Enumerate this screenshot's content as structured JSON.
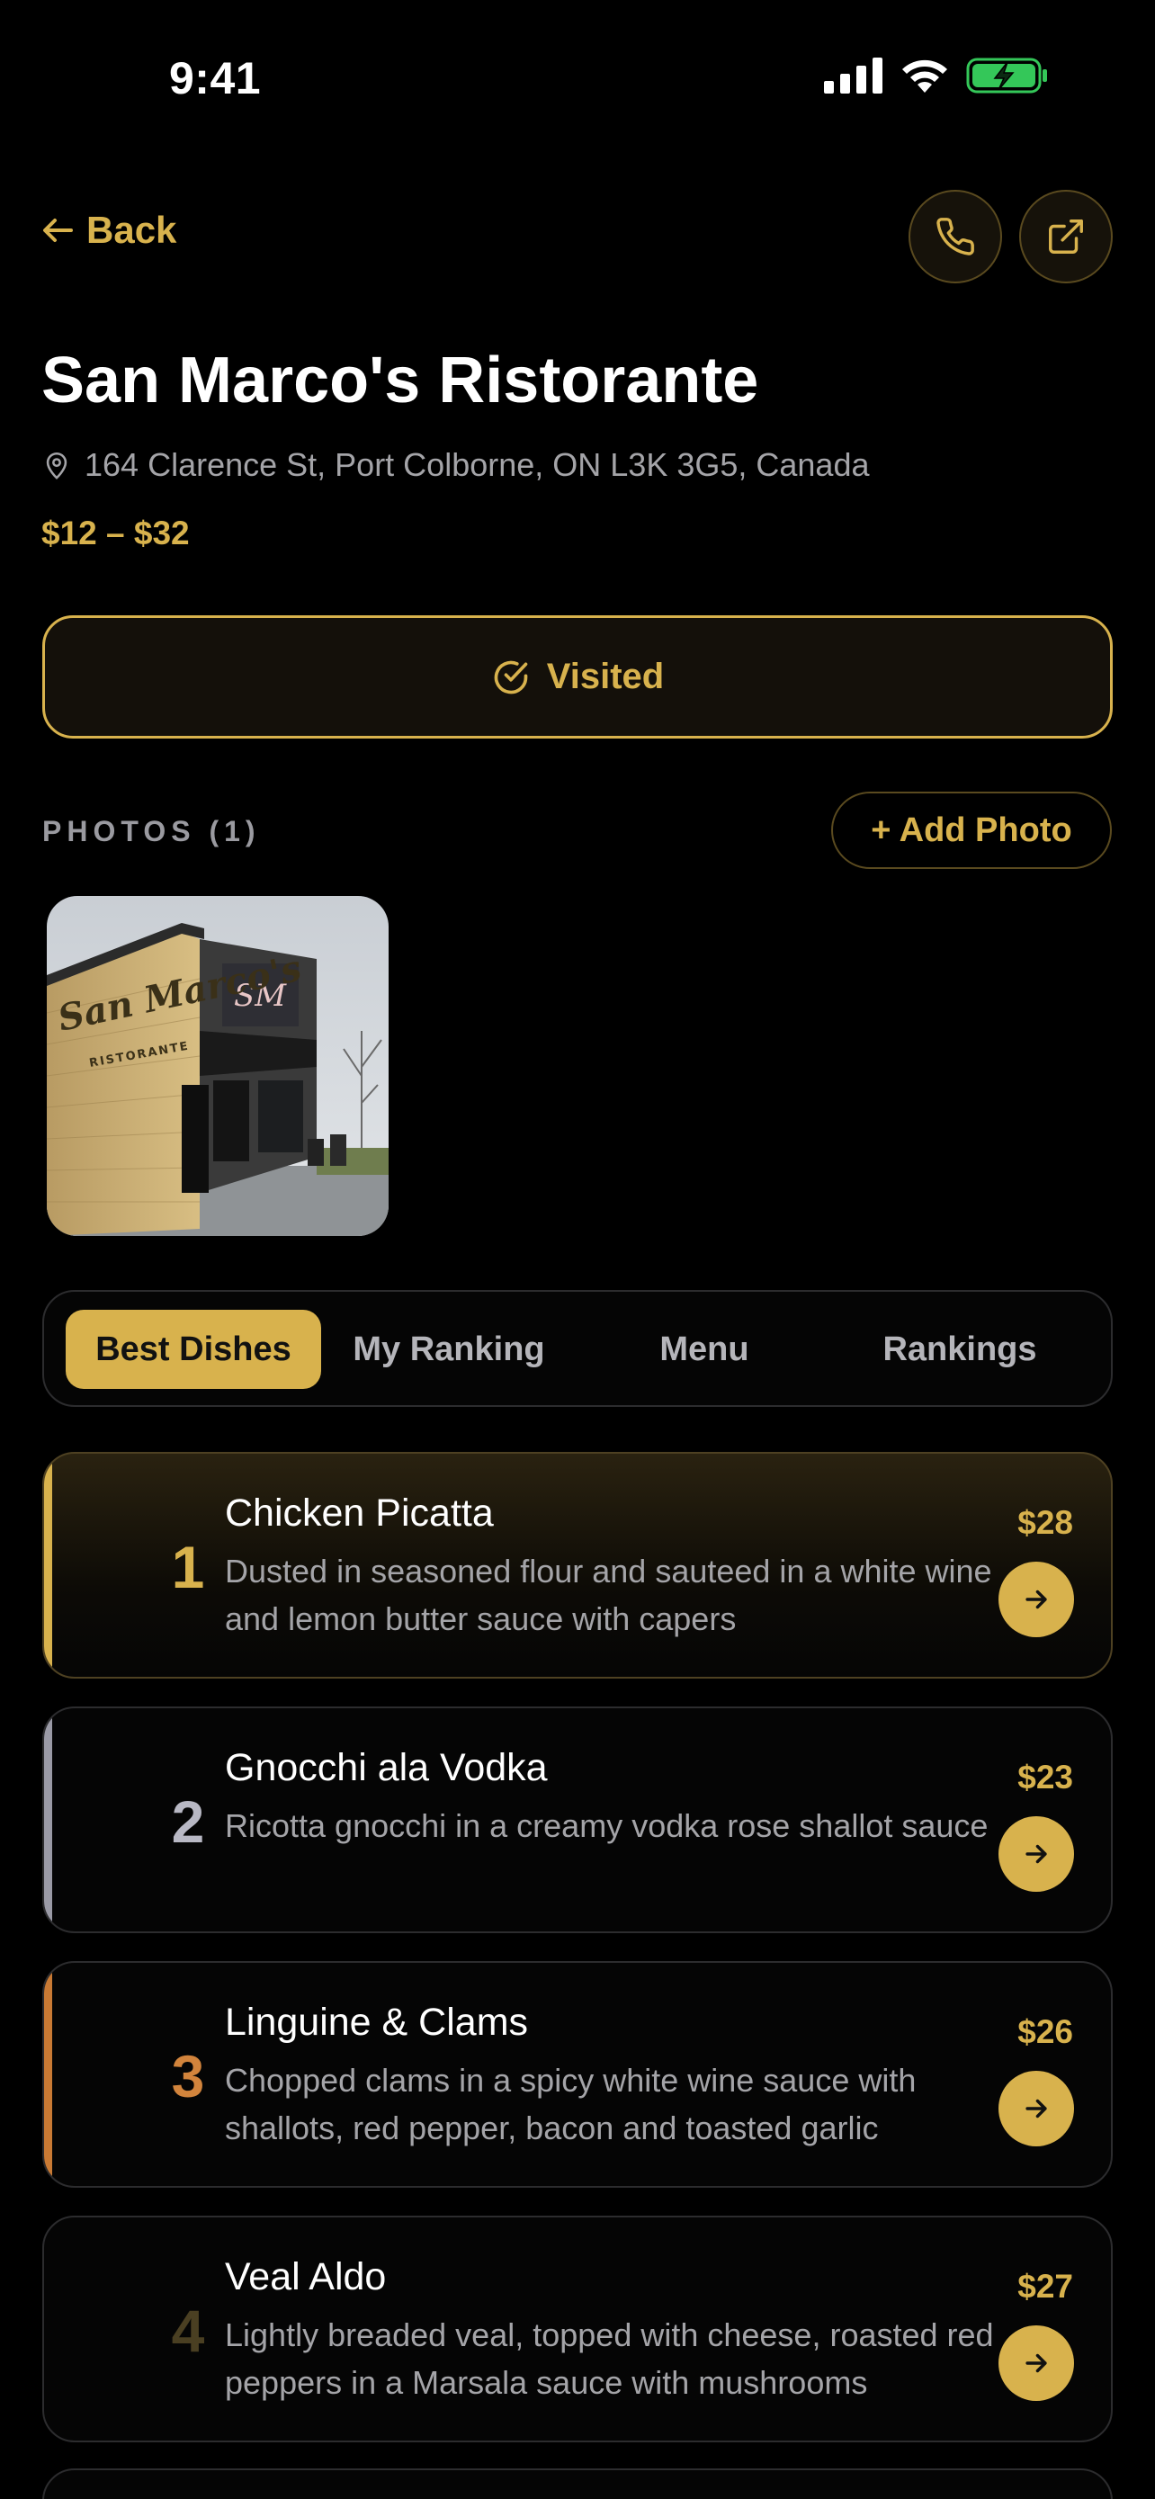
{
  "status": {
    "time": "9:41"
  },
  "nav": {
    "back_label": "Back"
  },
  "restaurant": {
    "name": "San Marco's Ristorante",
    "address": "164 Clarence St, Port Colborne, ON L3K 3G5, Canada",
    "price_range": "$12 – $32",
    "visited_label": "Visited",
    "sign_text": "San Marco's",
    "sign_sub": "RISTORANTE"
  },
  "photos": {
    "label": "PHOTOS (1)",
    "add_label": "+ Add Photo"
  },
  "tabs": [
    {
      "label": "Best Dishes",
      "active": true
    },
    {
      "label": "My Ranking",
      "active": false
    },
    {
      "label": "Menu",
      "active": false
    },
    {
      "label": "Rankings",
      "active": false
    }
  ],
  "dishes": [
    {
      "rank": "1",
      "name": "Chicken Picatta",
      "description": "Dusted in seasoned flour and sauteed in a white wine and lemon butter sauce with capers",
      "price": "$28",
      "rank_color": "#d8b24d",
      "accent": "#d8b24d"
    },
    {
      "rank": "2",
      "name": "Gnocchi ala Vodka",
      "description": "Ricotta gnocchi in a creamy vodka rose shallot sauce",
      "price": "$23",
      "rank_color": "#b8b8c4",
      "accent": "#9a9aa6"
    },
    {
      "rank": "3",
      "name": "Linguine & Clams",
      "description": "Chopped clams in a spicy white wine sauce with shallots, red pepper, bacon and toasted garlic",
      "price": "$26",
      "rank_color": "#d2843c",
      "accent": "#c97a34"
    },
    {
      "rank": "4",
      "name": "Veal Aldo",
      "description": "Lightly breaded veal, topped with cheese, roasted red peppers in a Marsala sauce with mushrooms",
      "price": "$27",
      "rank_color": "#4a3f22",
      "accent": ""
    }
  ],
  "colors": {
    "accent": "#d8b24d",
    "background": "#000000",
    "muted_text": "#a4a4a8"
  }
}
